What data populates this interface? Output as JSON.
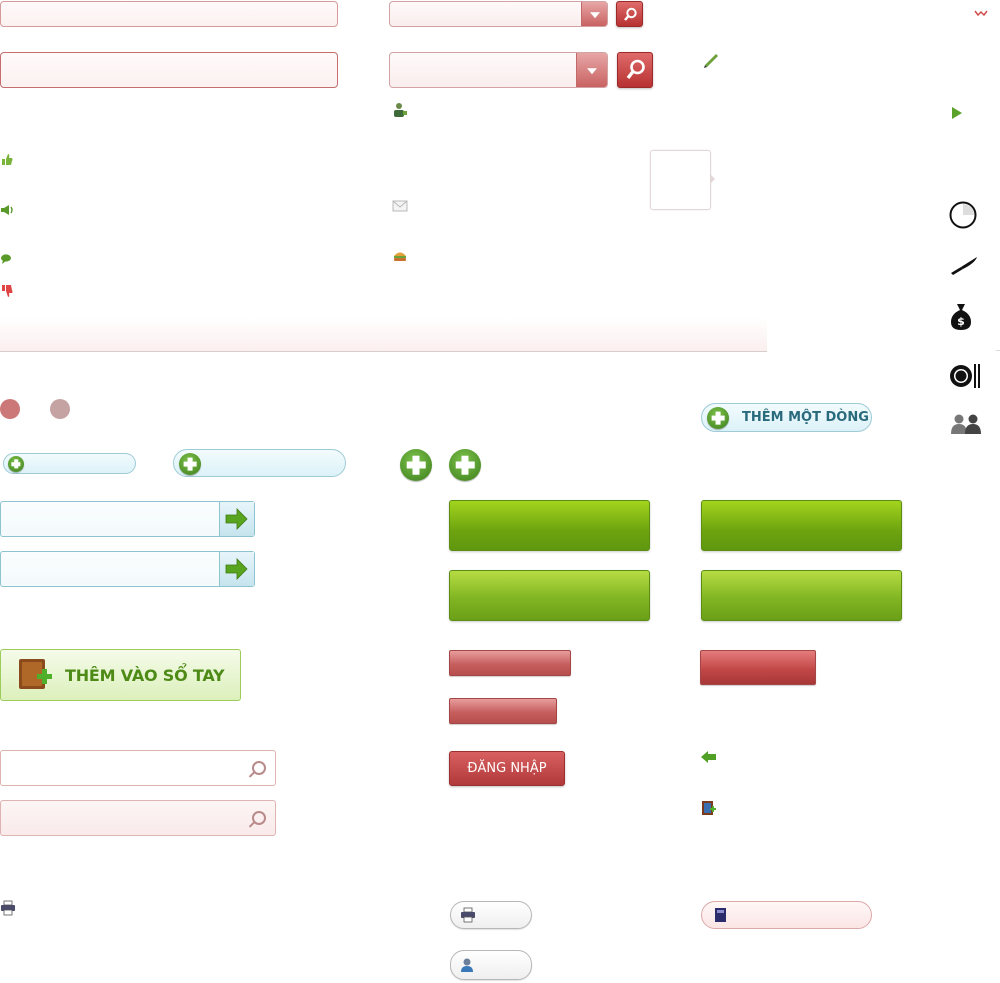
{
  "buttons": {
    "add_row_label": "THÊM MỘT DÒNG",
    "add_notebook_label": "THÊM VÀO SỔ TAY",
    "login_label": "ĐĂNG NHẬP"
  },
  "colors": {
    "brand_red": "#b73131",
    "brand_green": "#6ea40f",
    "accent_blue": "#2a6a7d"
  },
  "icons": {
    "pencil": "pencil-icon",
    "user_add": "user-add-icon",
    "thumbs_up": "thumbs-up-icon",
    "thumbs_down": "thumbs-down-icon",
    "megaphone": "megaphone-icon",
    "comment": "comment-icon",
    "mail": "mail-icon",
    "food": "food-icon",
    "play": "play-icon",
    "clock": "clock-icon",
    "knife": "knife-icon",
    "money_bag": "money-bag-icon",
    "plate": "plate-icon",
    "users": "users-icon",
    "back_arrow": "back-arrow-icon",
    "book_add": "book-add-icon",
    "print": "print-icon",
    "user": "user-icon",
    "book": "book-icon"
  }
}
